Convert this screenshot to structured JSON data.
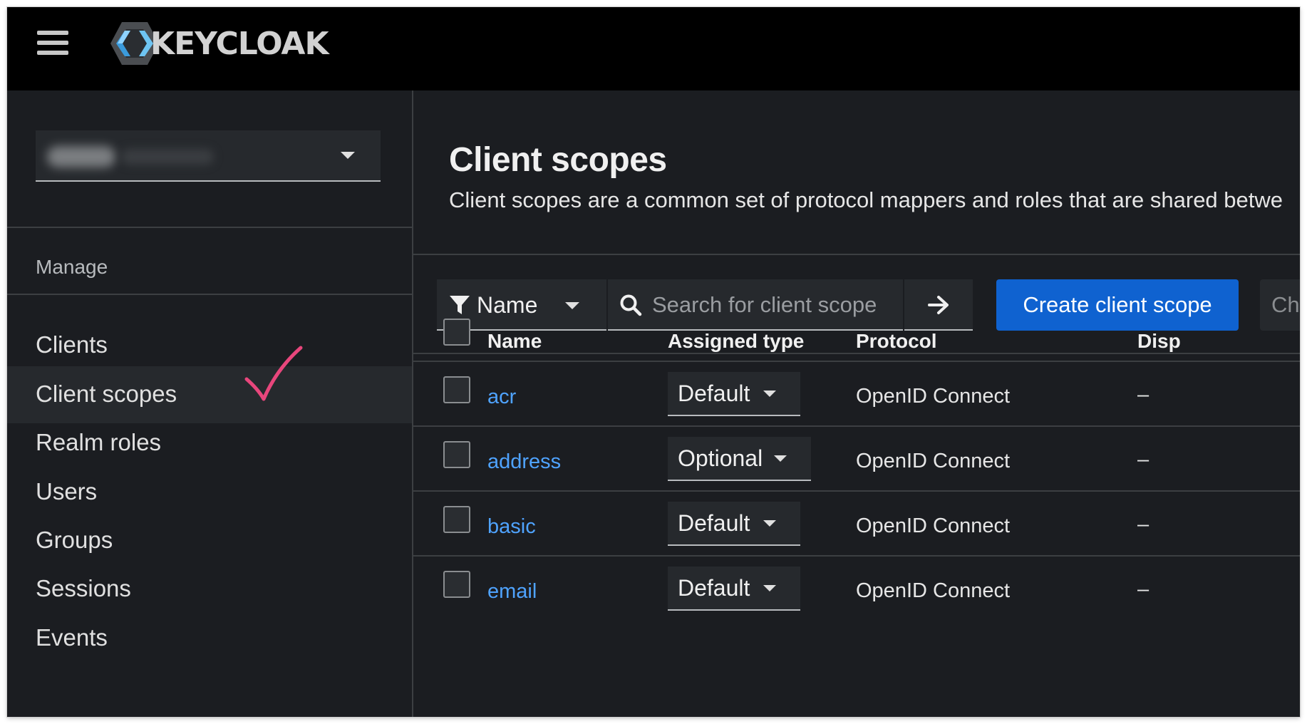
{
  "masthead": {
    "brand": "KEYCLOAK"
  },
  "sidebar": {
    "section_title": "Manage",
    "items": [
      {
        "label": "Clients"
      },
      {
        "label": "Client scopes"
      },
      {
        "label": "Realm roles"
      },
      {
        "label": "Users"
      },
      {
        "label": "Groups"
      },
      {
        "label": "Sessions"
      },
      {
        "label": "Events"
      }
    ],
    "active_item": "Client scopes"
  },
  "main": {
    "title": "Client scopes",
    "description": "Client scopes are a common set of protocol mappers and roles that are shared betwe",
    "toolbar": {
      "filter_label": "Name",
      "search_placeholder": "Search for client scope",
      "create_label": "Create client scope",
      "change_label": "Ch"
    },
    "table": {
      "headers": {
        "name": "Name",
        "assigned_type": "Assigned type",
        "protocol": "Protocol",
        "display": "Disp"
      },
      "rows": [
        {
          "name": "acr",
          "assigned_type": "Default",
          "protocol": "OpenID Connect",
          "display": "–"
        },
        {
          "name": "address",
          "assigned_type": "Optional",
          "protocol": "OpenID Connect",
          "display": "–"
        },
        {
          "name": "basic",
          "assigned_type": "Default",
          "protocol": "OpenID Connect",
          "display": "–"
        },
        {
          "name": "email",
          "assigned_type": "Default",
          "protocol": "OpenID Connect",
          "display": "–"
        }
      ]
    }
  },
  "colors": {
    "masthead_bg": "#000000",
    "page_bg": "#1b1d21",
    "primary_button": "#0f62d0",
    "link": "#4fa3ff",
    "annotation_check": "#e8467c"
  },
  "icons": [
    "hamburger-icon",
    "keycloak-logo",
    "caret-down-icon",
    "filter-icon",
    "search-icon",
    "arrow-right-icon",
    "checkmark-annotation"
  ]
}
